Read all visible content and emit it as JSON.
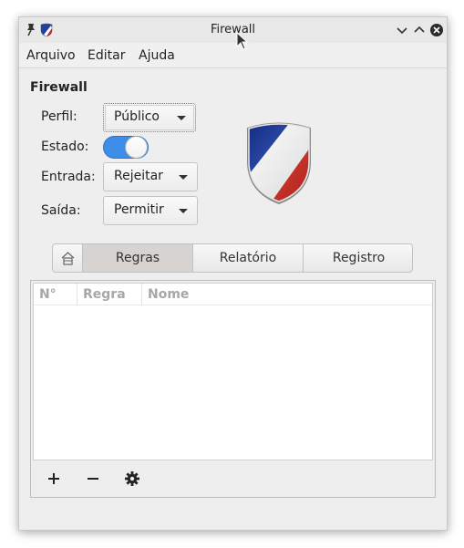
{
  "window": {
    "title": "Firewall"
  },
  "menubar": {
    "items": [
      "Arquivo",
      "Editar",
      "Ajuda"
    ]
  },
  "section_title": "Firewall",
  "form": {
    "profile_label": "Perfil:",
    "profile_value": "Público",
    "status_label": "Estado:",
    "status_on": true,
    "incoming_label": "Entrada:",
    "incoming_value": "Rejeitar",
    "outgoing_label": "Saída:",
    "outgoing_value": "Permitir"
  },
  "tabs": [
    {
      "label": "Regras",
      "active": true
    },
    {
      "label": "Relatório",
      "active": false
    },
    {
      "label": "Registro",
      "active": false
    }
  ],
  "table": {
    "columns": [
      "N°",
      "Regra",
      "Nome"
    ],
    "rows": []
  },
  "toolbar": {
    "add": "+",
    "remove": "−"
  },
  "icons": {
    "pin": "pin-icon",
    "app": "shield-icon",
    "minimize": "chevron-down-icon",
    "maximize": "chevron-up-icon",
    "close": "close-icon",
    "home": "home-icon",
    "settings": "gear-icon"
  },
  "colors": {
    "switch_on": "#3d8ee8",
    "shield_blue": "#1f3a8a",
    "shield_red": "#c22a2a"
  }
}
